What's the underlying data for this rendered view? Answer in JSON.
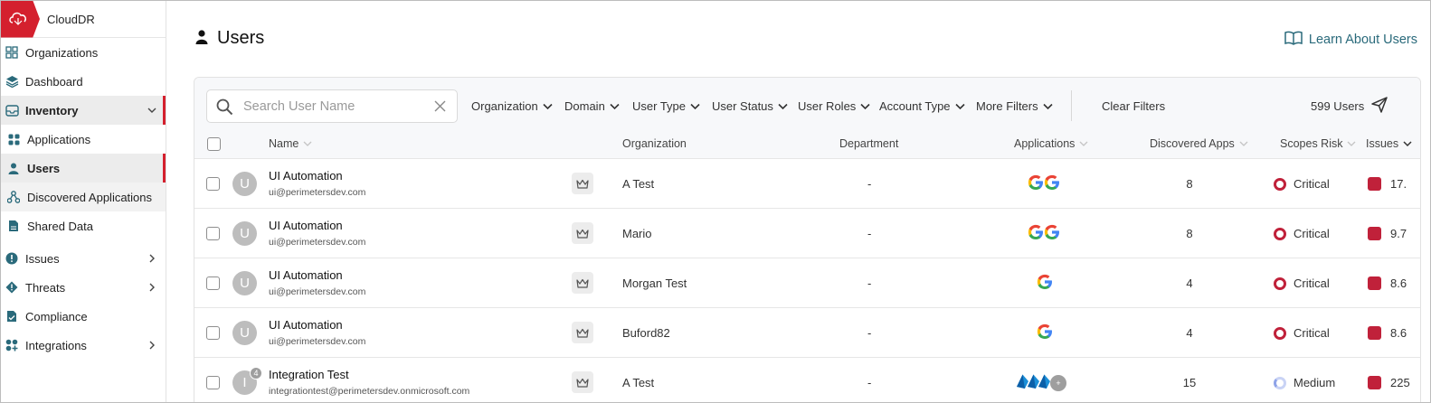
{
  "app": {
    "name": "CloudDR"
  },
  "sidebar": {
    "items": [
      {
        "label": "Organizations",
        "icon": "grid-icon"
      },
      {
        "label": "Dashboard",
        "icon": "layers-icon"
      },
      {
        "label": "Inventory",
        "icon": "inbox-icon",
        "expanded": true
      },
      {
        "label": "Applications",
        "icon": "apps-icon"
      },
      {
        "label": "Users",
        "icon": "user-icon",
        "active": true
      },
      {
        "label": "Discovered Applications",
        "icon": "nodes-icon"
      },
      {
        "label": "Shared Data",
        "icon": "file-icon"
      },
      {
        "label": "Issues",
        "icon": "alert-icon"
      },
      {
        "label": "Threats",
        "icon": "threat-icon"
      },
      {
        "label": "Compliance",
        "icon": "compliance-icon"
      },
      {
        "label": "Integrations",
        "icon": "integrations-icon"
      }
    ]
  },
  "page": {
    "title": "Users",
    "learn_link": "Learn About Users"
  },
  "toolbar": {
    "search_placeholder": "Search User Name",
    "filters": [
      "Organization",
      "Domain",
      "User Type",
      "User Status",
      "User Roles",
      "Account Type",
      "More Filters"
    ],
    "clear_filters": "Clear Filters",
    "user_count": "599 Users"
  },
  "table": {
    "columns": [
      "Name",
      "Organization",
      "Department",
      "Applications",
      "Discovered Apps",
      "Scopes Risk",
      "Issues"
    ],
    "rows": [
      {
        "initial": "U",
        "name": "UI Automation",
        "email": "ui@perimetersdev.com",
        "organization": "A Test",
        "department": "-",
        "apps": "google-google",
        "discovered": "8",
        "risk": "Critical",
        "issues": "17."
      },
      {
        "initial": "U",
        "name": "UI Automation",
        "email": "ui@perimetersdev.com",
        "organization": "Mario",
        "department": "-",
        "apps": "google-google",
        "discovered": "8",
        "risk": "Critical",
        "issues": "9.7"
      },
      {
        "initial": "U",
        "name": "UI Automation",
        "email": "ui@perimetersdev.com",
        "organization": "Morgan Test",
        "department": "-",
        "apps": "google",
        "discovered": "4",
        "risk": "Critical",
        "issues": "8.6"
      },
      {
        "initial": "U",
        "name": "UI Automation",
        "email": "ui@perimetersdev.com",
        "organization": "Buford82",
        "department": "-",
        "apps": "google",
        "discovered": "4",
        "risk": "Critical",
        "issues": "8.6"
      },
      {
        "initial": "I",
        "badge": "4",
        "name": "Integration Test",
        "email": "integrationtest@perimetersdev.onmicrosoft.com",
        "organization": "A Test",
        "department": "-",
        "apps": "microsoft-multi",
        "discovered": "15",
        "risk": "Medium",
        "issues": "225"
      }
    ]
  },
  "colors": {
    "brand": "#d4202e",
    "critical": "#c0213a",
    "link": "#2a6a7b"
  }
}
